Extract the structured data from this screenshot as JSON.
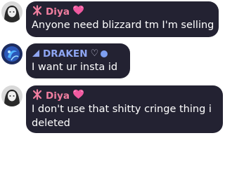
{
  "messages": [
    {
      "author": {
        "name": "Diya",
        "name_color": "#f07ea0",
        "badge": "sparkle-icon",
        "suffix_icon": "heart-icon"
      },
      "text": "Anyone need blizzard tm I'm selling"
    },
    {
      "author": {
        "name": "DRAKEN",
        "name_color": "#8fa6f3",
        "badge": "triangle-flag-icon",
        "suffix_text": "♡",
        "suffix_icon": "blue-dot-icon"
      },
      "text": "I want ur insta id"
    },
    {
      "author": {
        "name": "Diya",
        "name_color": "#f07ea0",
        "badge": "sparkle-icon",
        "suffix_icon": "heart-icon"
      },
      "text": "I don't use that shitty cringe thing i deleted"
    }
  ]
}
